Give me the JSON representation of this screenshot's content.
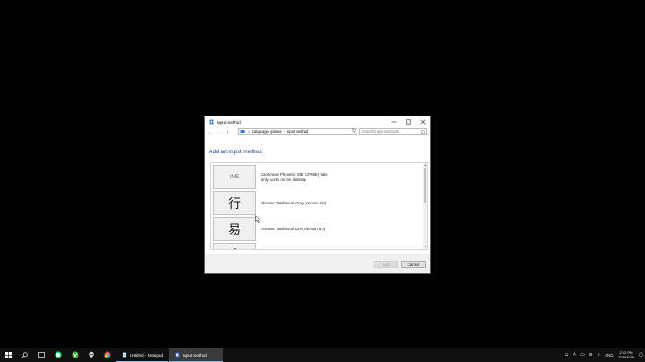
{
  "window": {
    "title": "Input method",
    "minimize": "—",
    "maximize": "☐",
    "close": "✕"
  },
  "addressbar": {
    "back": "←",
    "forward": "→",
    "recent": "⌄",
    "up": "↑",
    "sep1": "«",
    "crumb1": "Language options",
    "sep2": "›",
    "crumb2": "Input method",
    "dropdown": "⌄",
    "refresh": "↻",
    "search_placeholder": "Search input methods"
  },
  "heading": "Add an input method",
  "list": {
    "items": [
      {
        "tile": "IME",
        "line1": "Cantonese Phonetic IME (CPIME) Yale",
        "line2": "Only works on the desktop"
      },
      {
        "tile": "行",
        "line1": "Chinese Traditional Array (version 6.0)",
        "line2": ""
      },
      {
        "tile": "易",
        "line1": "Chinese Traditional DaYi (version 6.0)",
        "line2": ""
      },
      {
        "tile": "人",
        "line1": "",
        "line2": ""
      }
    ],
    "scroll_up": "▲",
    "scroll_down": "▼"
  },
  "footer": {
    "add_label": "Add",
    "cancel_label": "Cancel"
  },
  "taskbar": {
    "apps": [
      {
        "label": "Untitled - Notepad"
      },
      {
        "label": "Input method"
      }
    ],
    "tray": {
      "language": "ENG",
      "time": "2:12 PM",
      "date": "23/8/2018"
    }
  },
  "colors": {
    "heading": "#1e3b8b",
    "taskbar": "#101010",
    "accent": "#8fb7e8"
  }
}
